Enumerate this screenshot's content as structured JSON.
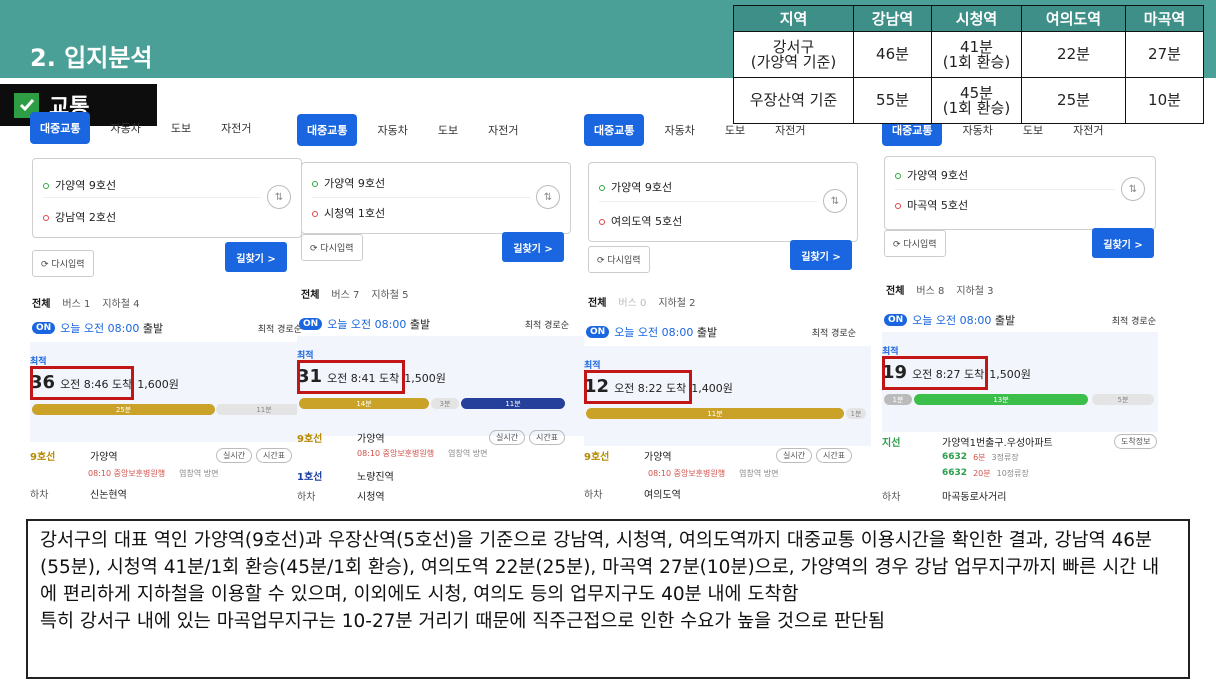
{
  "header": {
    "title": "2. 입지분석",
    "tag": "교통"
  },
  "table": {
    "headers": [
      "지역",
      "강남역",
      "시청역",
      "여의도역",
      "마곡역"
    ],
    "rows": [
      {
        "region": "강서구\n(가양역 기준)",
        "cells": [
          "46분",
          "41분\n(1회 환승)",
          "22분",
          "27분"
        ]
      },
      {
        "region": "우장산역 기준",
        "cells": [
          "55분",
          "45분\n(1회 환승)",
          "25분",
          "10분"
        ]
      }
    ]
  },
  "tabs": {
    "transit": "대중교통",
    "car": "자동차",
    "walk": "도보",
    "bike": "자전거"
  },
  "common": {
    "reset": "다시입력",
    "search": "길찾기 >",
    "all": "전체",
    "on": "ON",
    "sort": "최적 경로순",
    "best": "최적",
    "dep": "출발",
    "realtime": "실시간",
    "timetable": "시간표",
    "alight": "하차",
    "door": "도착정보"
  },
  "panels": [
    {
      "from": "가양역 9호선",
      "to": "강남역 2호선",
      "bus": "버스 1",
      "sub": "지하철 4",
      "date": "오늘 오전 08:00",
      "min": "36",
      "arr": "오전 8:46 도착",
      "fare": "1,600원",
      "seg1": "25분",
      "seg2": "11분",
      "line": "9호선",
      "stop": "가양역",
      "info": "08:10 중앙보훈병원행",
      "tail": "염창역 방면",
      "next": "신논현역"
    },
    {
      "from": "가양역 9호선",
      "to": "시청역 1호선",
      "bus": "버스 7",
      "sub": "지하철 5",
      "date": "오늘 오전 08:00",
      "min": "31",
      "arr": "오전 8:41 도착",
      "fare": "1,500원",
      "seg1": "14분",
      "seg2": "3분",
      "seg3": "11분",
      "line": "9호선",
      "stop": "가양역",
      "info": "08:10 중앙보훈병원행",
      "tail": "염창역 방면",
      "line2": "1호선",
      "stop2": "노량진역",
      "next": "시청역"
    },
    {
      "from": "가양역 9호선",
      "to": "여의도역 5호선",
      "bus": "버스 0",
      "sub": "지하철 2",
      "date": "오늘 오전 08:00",
      "min": "12",
      "arr": "오전 8:22 도착",
      "fare": "1,400원",
      "seg1": "11분",
      "seg2": "1분",
      "line": "9호선",
      "stop": "가양역",
      "info": "08:10 중앙보훈병원행",
      "tail": "염창역 방면",
      "next": "여의도역"
    },
    {
      "from": "가양역 9호선",
      "to": "마곡역 5호선",
      "bus": "버스 8",
      "sub": "지하철 3",
      "date": "오늘 오전 08:00",
      "min": "19",
      "arr": "오전 8:27 도착",
      "fare": "1,500원",
      "seg0": "1분",
      "seg1": "13분",
      "seg2": "5분",
      "line": "지선",
      "stop": "가양역1번출구.우성아파트",
      "b1": "6632",
      "b1t": "6분",
      "b1s": "3정류장",
      "b2": "6632",
      "b2t": "20분",
      "b2s": "10정류장",
      "next": "마곡동로사거리"
    }
  ],
  "description": [
    "강서구의 대표 역인 가양역(9호선)과 우장산역(5호선)을 기준으로 강남역, 시청역, 여의도역까지 대중교통 이용시간을 확인한 결과, 강남역 46분(55분), 시청역 41분/1회 환승(45분/1회 환승), 여의도역 22분(25분), 마곡역 27분(10분)으로, 가양역의 경우 강남 업무지구까지 빠른 시간 내에 편리하게 지하철을 이용할 수 있으며, 이외에도 시청, 여의도 등의 업무지구도 40분 내에 도착함",
    "특히 강서구 내에 있는 마곡업무지구는 10-27분 거리기 때문에 직주근접으로 인한 수요가 높을 것으로 판단됨"
  ]
}
